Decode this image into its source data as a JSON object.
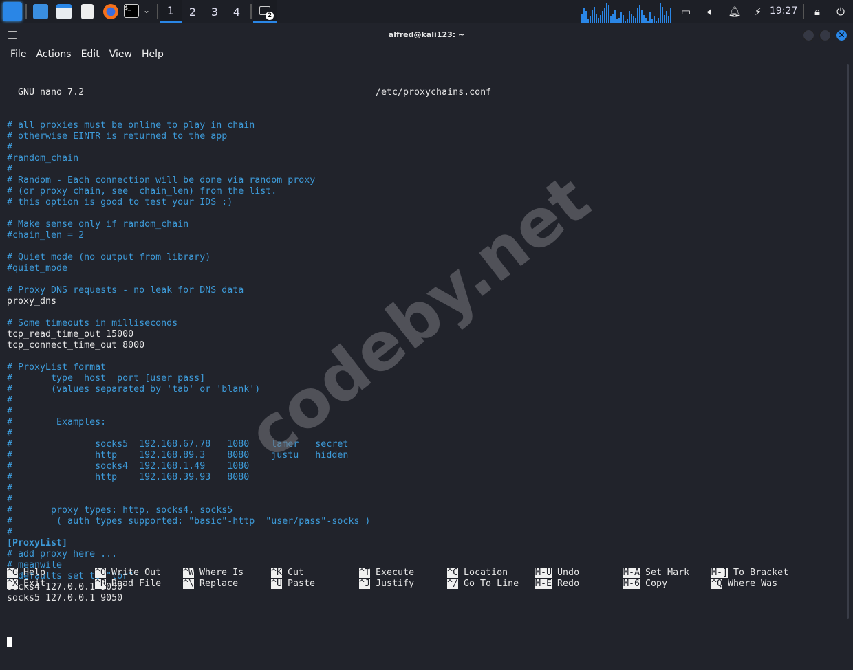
{
  "taskbar": {
    "workspaces": [
      "1",
      "2",
      "3",
      "4"
    ],
    "active_workspace": "1",
    "terminal_badge": "2",
    "clock": "19:27",
    "accent": "#2a86e6"
  },
  "window": {
    "title": "alfred@kali123: ~",
    "menu": [
      "File",
      "Actions",
      "Edit",
      "View",
      "Help"
    ]
  },
  "nano": {
    "version": "  GNU nano 7.2",
    "filename": "/etc/proxychains.conf",
    "lines": [
      {
        "t": "# all proxies must be online to play in chain",
        "k": "c"
      },
      {
        "t": "# otherwise EINTR is returned to the app",
        "k": "c"
      },
      {
        "t": "#",
        "k": "c"
      },
      {
        "t": "#random_chain",
        "k": "c"
      },
      {
        "t": "#",
        "k": "c"
      },
      {
        "t": "# Random - Each connection will be done via random proxy",
        "k": "c"
      },
      {
        "t": "# (or proxy chain, see  chain_len) from the list.",
        "k": "c"
      },
      {
        "t": "# this option is good to test your IDS :)",
        "k": "c"
      },
      {
        "t": "",
        "k": "n"
      },
      {
        "t": "# Make sense only if random_chain",
        "k": "c"
      },
      {
        "t": "#chain_len = 2",
        "k": "c"
      },
      {
        "t": "",
        "k": "n"
      },
      {
        "t": "# Quiet mode (no output from library)",
        "k": "c"
      },
      {
        "t": "#quiet_mode",
        "k": "c"
      },
      {
        "t": "",
        "k": "n"
      },
      {
        "t": "# Proxy DNS requests - no leak for DNS data",
        "k": "c"
      },
      {
        "t": "proxy_dns",
        "k": "n"
      },
      {
        "t": "",
        "k": "n"
      },
      {
        "t": "# Some timeouts in milliseconds",
        "k": "c"
      },
      {
        "t": "tcp_read_time_out 15000",
        "k": "n"
      },
      {
        "t": "tcp_connect_time_out 8000",
        "k": "n"
      },
      {
        "t": "",
        "k": "n"
      },
      {
        "t": "# ProxyList format",
        "k": "c"
      },
      {
        "t": "#       type  host  port [user pass]",
        "k": "c"
      },
      {
        "t": "#       (values separated by 'tab' or 'blank')",
        "k": "c"
      },
      {
        "t": "#",
        "k": "c"
      },
      {
        "t": "#",
        "k": "c"
      },
      {
        "t": "#        Examples:",
        "k": "c"
      },
      {
        "t": "#",
        "k": "c"
      },
      {
        "t": "#               socks5  192.168.67.78   1080    lamer   secret",
        "k": "c"
      },
      {
        "t": "#               http    192.168.89.3    8080    justu   hidden",
        "k": "c"
      },
      {
        "t": "#               socks4  192.168.1.49    1080",
        "k": "c"
      },
      {
        "t": "#               http    192.168.39.93   8080",
        "k": "c"
      },
      {
        "t": "#",
        "k": "c"
      },
      {
        "t": "#",
        "k": "c"
      },
      {
        "t": "#       proxy types: http, socks4, socks5",
        "k": "c"
      },
      {
        "t": "#        ( auth types supported: \"basic\"-http  \"user/pass\"-socks )",
        "k": "c"
      },
      {
        "t": "#",
        "k": "c"
      },
      {
        "t": "[ProxyList]",
        "k": "s"
      },
      {
        "t": "# add proxy here ...",
        "k": "c"
      },
      {
        "t": "# meanwile",
        "k": "c"
      },
      {
        "t": "# defaults set to \"tor\"",
        "k": "c"
      },
      {
        "t": "socks4 127.0.0.1 9050",
        "k": "n"
      },
      {
        "t": "socks5 127.0.0.1 9050",
        "k": "n"
      },
      {
        "t": "",
        "k": "n"
      }
    ],
    "shortcuts": [
      {
        "key": "^G",
        "label": "Help"
      },
      {
        "key": "^X",
        "label": "Exit"
      },
      {
        "key": "^O",
        "label": "Write Out"
      },
      {
        "key": "^R",
        "label": "Read File"
      },
      {
        "key": "^W",
        "label": "Where Is"
      },
      {
        "key": "^\\",
        "label": "Replace"
      },
      {
        "key": "^K",
        "label": "Cut"
      },
      {
        "key": "^U",
        "label": "Paste"
      },
      {
        "key": "^T",
        "label": "Execute"
      },
      {
        "key": "^J",
        "label": "Justify"
      },
      {
        "key": "^C",
        "label": "Location"
      },
      {
        "key": "^/",
        "label": "Go To Line"
      },
      {
        "key": "M-U",
        "label": "Undo"
      },
      {
        "key": "M-E",
        "label": "Redo"
      },
      {
        "key": "M-A",
        "label": "Set Mark"
      },
      {
        "key": "M-6",
        "label": "Copy"
      },
      {
        "key": "M-]",
        "label": "To Bracket"
      },
      {
        "key": "^Q",
        "label": "Where Was"
      }
    ]
  },
  "watermark": "codeby.net"
}
